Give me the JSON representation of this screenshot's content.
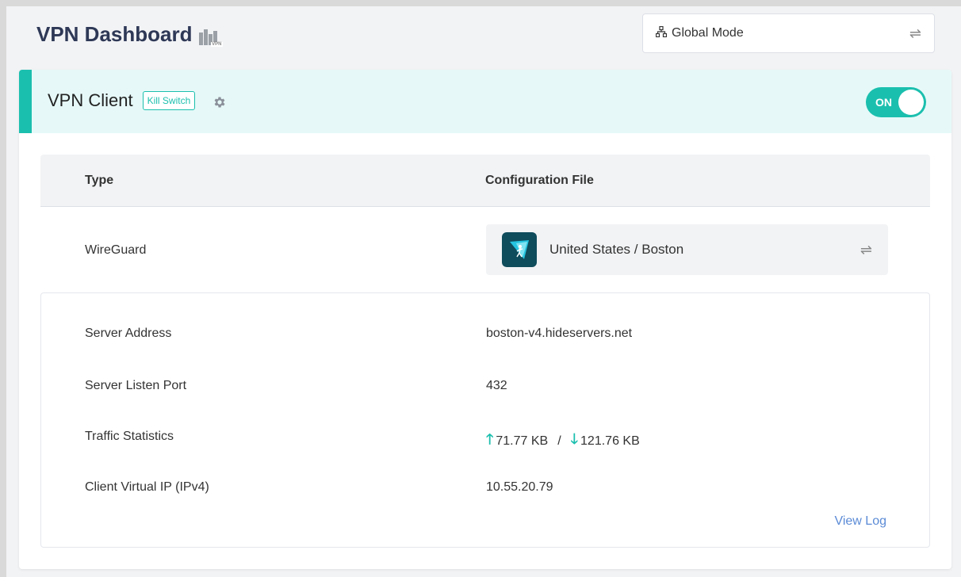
{
  "header": {
    "title": "VPN Dashboard",
    "icon": "vpn-map-icon",
    "icon_tag": "VPN"
  },
  "mode_select": {
    "value": "Global Mode",
    "icon": "network-tree-icon"
  },
  "client": {
    "title": "VPN Client",
    "kill_switch_label": "Kill Switch",
    "toggle_label": "ON",
    "toggle_on": true
  },
  "table": {
    "col_type": "Type",
    "col_config": "Configuration File",
    "type_value": "WireGuard",
    "config_value": "United States / Boston"
  },
  "details": {
    "rows": [
      {
        "label": "Server Address",
        "value": "boston-v4.hideservers.net"
      },
      {
        "label": "Server Listen Port",
        "value": "432"
      },
      {
        "label": "Traffic Statistics",
        "upload": "71.77 KB",
        "separator": "/",
        "download": "121.76 KB"
      },
      {
        "label": "Client Virtual IP (IPv4)",
        "value": "10.55.20.79"
      }
    ],
    "view_log": "View Log"
  },
  "colors": {
    "accent": "#1bbfae",
    "title": "#2e3856",
    "link": "#5b8bd6",
    "header_bg": "#e6f9f8"
  }
}
